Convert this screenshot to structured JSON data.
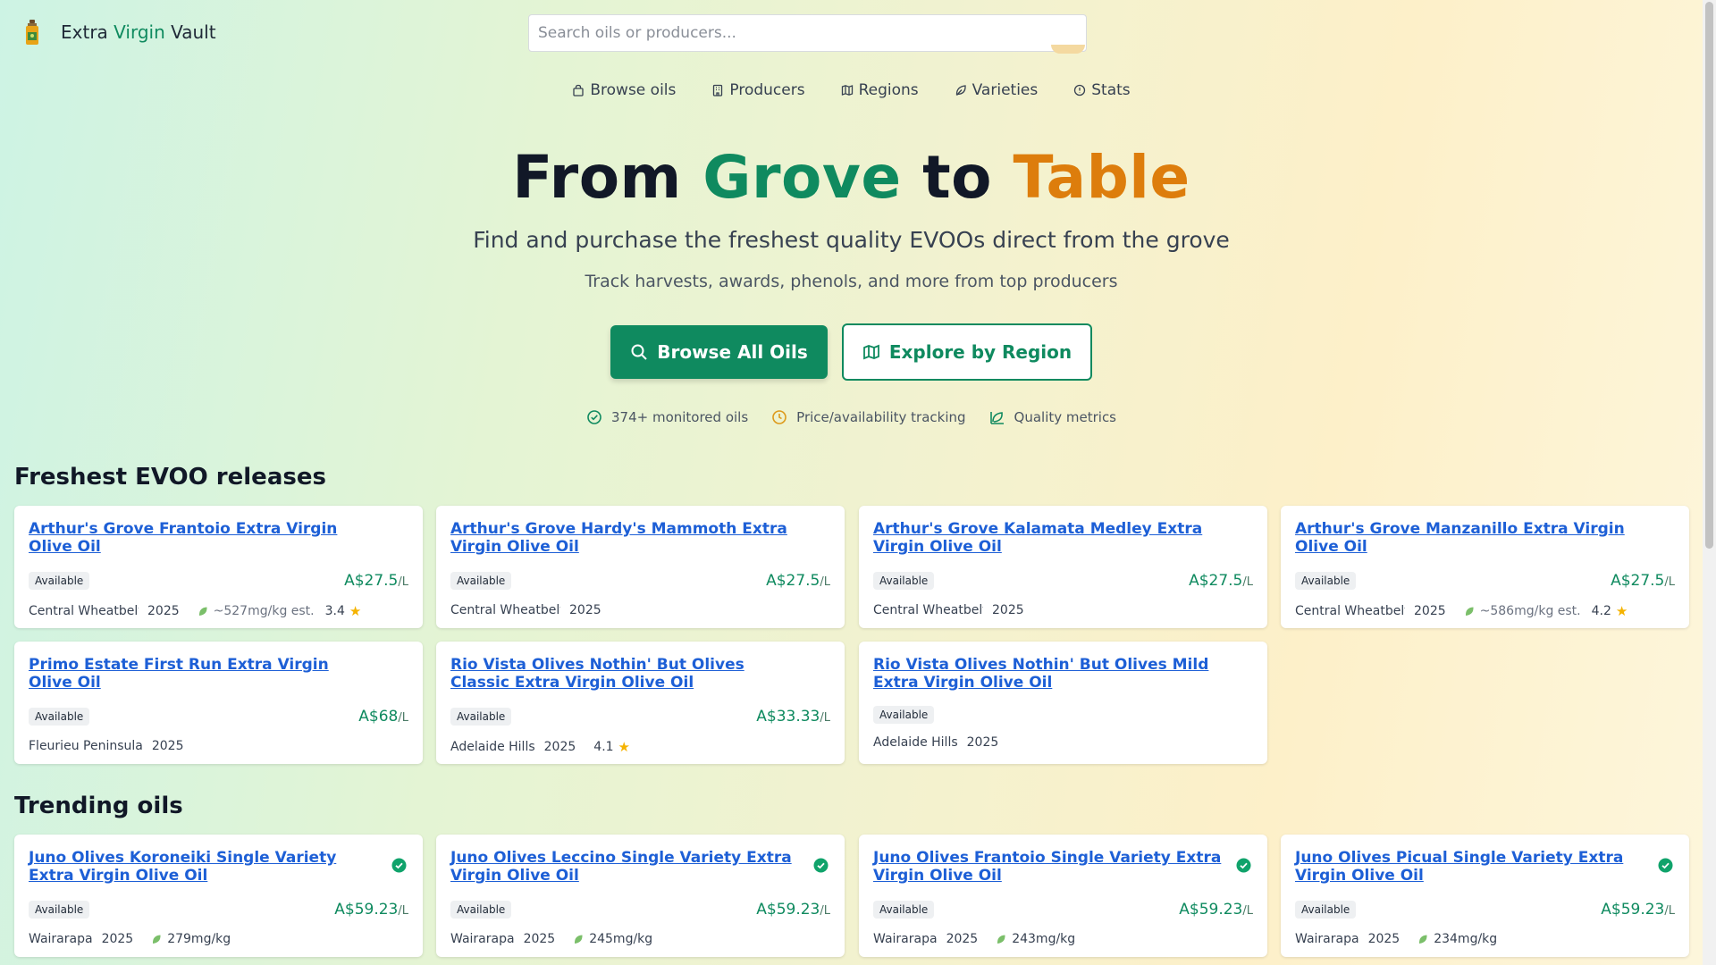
{
  "brand": {
    "part1": "Extra ",
    "part2": "Virgin",
    "part3": " Vault"
  },
  "search": {
    "placeholder": "Search oils or producers..."
  },
  "nav": [
    {
      "label": "Browse oils",
      "icon": "bag-icon"
    },
    {
      "label": "Producers",
      "icon": "building-icon"
    },
    {
      "label": "Regions",
      "icon": "map-icon"
    },
    {
      "label": "Varieties",
      "icon": "leaf-icon"
    },
    {
      "label": "Stats",
      "icon": "info-icon"
    }
  ],
  "hero": {
    "title_a": "From ",
    "title_b": "Grove",
    "title_c": " to ",
    "title_d": "Table",
    "subtitle": "Find and purchase the freshest quality EVOOs direct from the grove",
    "tagline": "Track harvests, awards, phenols, and more from top producers",
    "primary_button": "Browse All Oils",
    "secondary_button": "Explore by Region"
  },
  "features": [
    {
      "label": "374+ monitored oils",
      "icon": "check-circle-icon"
    },
    {
      "label": "Price/availability tracking",
      "icon": "clock-icon"
    },
    {
      "label": "Quality metrics",
      "icon": "chart-leaf-icon"
    }
  ],
  "sections": {
    "freshest": "Freshest EVOO releases",
    "trending": "Trending oils"
  },
  "colors": {
    "accent": "#0f8a5f",
    "orange": "#dd7d0c",
    "link": "#1d5fd6"
  },
  "freshest": [
    {
      "title": "Arthur's Grove Frantoio Extra Virgin Olive Oil",
      "status": "Available",
      "price": "A$27.5",
      "unit": "/L",
      "region": "Central Wheatbelt",
      "year": "2025",
      "phenol": "~527mg/kg est.",
      "rating": "3.4"
    },
    {
      "title": "Arthur's Grove Hardy's Mammoth Extra Virgin Olive Oil",
      "status": "Available",
      "price": "A$27.5",
      "unit": "/L",
      "region": "Central Wheatbelt",
      "year": "2025"
    },
    {
      "title": "Arthur's Grove Kalamata Medley Extra Virgin Olive Oil",
      "status": "Available",
      "price": "A$27.5",
      "unit": "/L",
      "region": "Central Wheatbelt",
      "year": "2025"
    },
    {
      "title": "Arthur's Grove Manzanillo Extra Virgin Olive Oil",
      "status": "Available",
      "price": "A$27.5",
      "unit": "/L",
      "region": "Central Wheatbelt",
      "year": "2025",
      "phenol": "~586mg/kg est.",
      "rating": "4.2"
    },
    {
      "title": "Primo Estate First Run Extra Virgin Olive Oil",
      "status": "Available",
      "price": "A$68",
      "unit": "/L",
      "region": "Fleurieu Peninsula",
      "year": "2025"
    },
    {
      "title": "Rio Vista Olives Nothin' But Olives Classic Extra Virgin Olive Oil",
      "status": "Available",
      "price": "A$33.33",
      "unit": "/L",
      "region": "Adelaide Hills",
      "year": "2025",
      "rating": "4.1"
    },
    {
      "title": "Rio Vista Olives Nothin' But Olives Mild Extra Virgin Olive Oil",
      "status": "Available",
      "region": "Adelaide Hills",
      "year": "2025"
    }
  ],
  "trending": [
    {
      "title": "Juno Olives Koroneiki Single Variety Extra Virgin Olive Oil",
      "status": "Available",
      "price": "A$59.23",
      "unit": "/L",
      "region": "Wairarapa",
      "year": "2025",
      "phenol": "279mg/kg"
    },
    {
      "title": "Juno Olives Leccino Single Variety Extra Virgin Olive Oil",
      "status": "Available",
      "price": "A$59.23",
      "unit": "/L",
      "region": "Wairarapa",
      "year": "2025",
      "phenol": "245mg/kg"
    },
    {
      "title": "Juno Olives Frantoio Single Variety Extra Virgin Olive Oil",
      "status": "Available",
      "price": "A$59.23",
      "unit": "/L",
      "region": "Wairarapa",
      "year": "2025",
      "phenol": "243mg/kg"
    },
    {
      "title": "Juno Olives Picual Single Variety Extra Virgin Olive Oil",
      "status": "Available",
      "price": "A$59.23",
      "unit": "/L",
      "region": "Wairarapa",
      "year": "2025",
      "phenol": "234mg/kg"
    }
  ]
}
